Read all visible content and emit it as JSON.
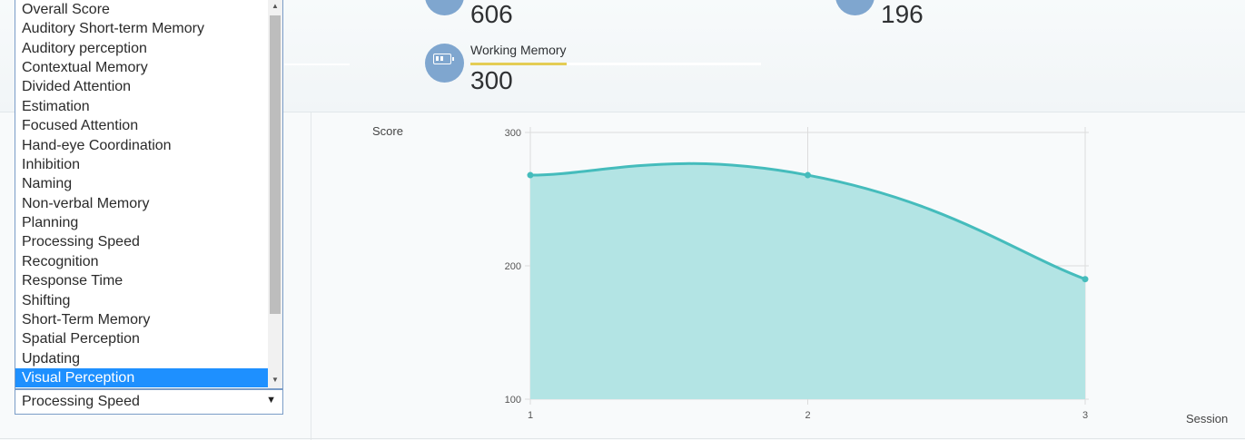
{
  "stats": [
    {
      "label": "",
      "value": "606"
    },
    {
      "label": "",
      "value": "196"
    },
    {
      "label": "Working Memory",
      "value": "300",
      "level": 0.33
    }
  ],
  "dropdown": {
    "options": [
      "Overall Score",
      "Auditory Short-term Memory",
      "Auditory perception",
      "Contextual Memory",
      "Divided Attention",
      "Estimation",
      "Focused Attention",
      "Hand-eye Coordination",
      "Inhibition",
      "Naming",
      "Non-verbal Memory",
      "Planning",
      "Processing Speed",
      "Recognition",
      "Response Time",
      "Shifting",
      "Short-Term Memory",
      "Spatial Perception",
      "Updating",
      "Visual Perception"
    ],
    "highlighted": "Visual Perception",
    "selected_value": "Processing Speed",
    "arrow": "▼"
  },
  "colors": {
    "accent": "#1e90ff",
    "icon_bg": "#7fa6cf",
    "bar_fill": "#e4cd55",
    "line": "#45bcbc",
    "area": "#b3e4e4"
  },
  "chart_data": {
    "type": "area",
    "x": [
      1,
      2,
      3
    ],
    "values": [
      268,
      268,
      190
    ],
    "xlabel": "Session",
    "ylabel": "Score",
    "ylim": [
      100,
      300
    ],
    "yticks": [
      "300",
      "200",
      "100"
    ],
    "xticks": [
      "1",
      "2",
      "3"
    ],
    "grid": true
  }
}
